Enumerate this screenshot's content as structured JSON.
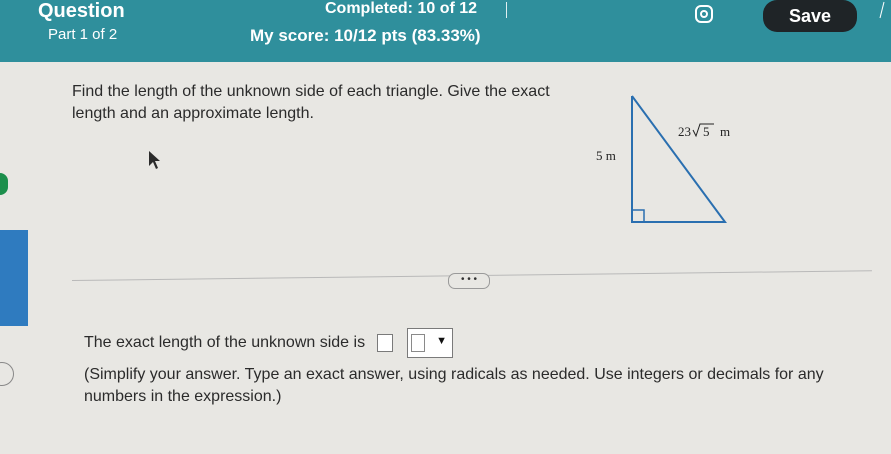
{
  "header": {
    "title": "Question",
    "part": "Part 1 of 2",
    "completed": "Completed: 10 of 12",
    "score": "My score: 10/12 pts (83.33%)",
    "save_label": "Save"
  },
  "question": {
    "text": "Find the length of the unknown side of each triangle. Give the exact length and an approximate length.",
    "side_leg": "5 m",
    "side_hyp_coef": "23",
    "side_hyp_radicand": "5",
    "side_hyp_unit": "m"
  },
  "answer": {
    "prompt": "The exact length of the unknown side is",
    "more_label": "• • •",
    "instructions": "(Simplify your answer. Type an exact answer, using radicals as needed. Use integers or decimals for any numbers in the expression.)"
  },
  "icons": {
    "settings": "gear-icon",
    "cursor": "mouse-pointer-icon",
    "dropdown": "caret-down-icon"
  },
  "colors": {
    "header_bg": "#2f8f9c",
    "save_bg": "#1f2427"
  }
}
